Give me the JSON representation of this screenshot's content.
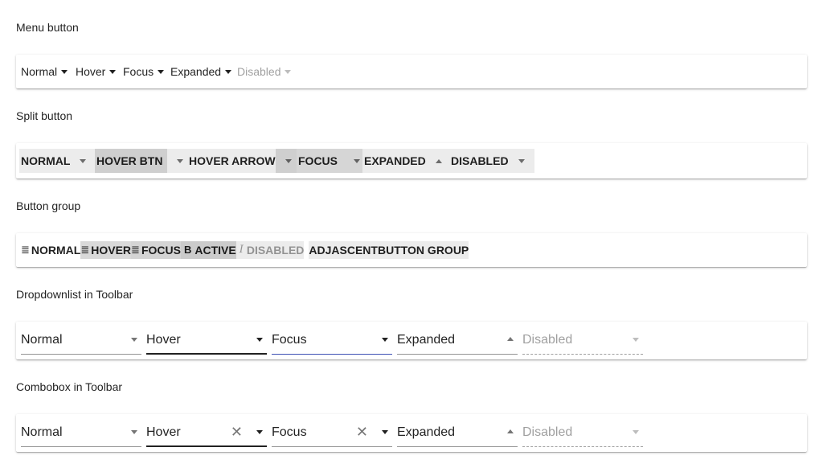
{
  "sections": {
    "menu_button": {
      "label": "Menu button",
      "items": [
        "Normal",
        "Hover",
        "Focus",
        "Expanded",
        "Disabled"
      ]
    },
    "split_button": {
      "label": "Split button",
      "items": [
        "NORMAL",
        "HOVER BTN",
        "HOVER ARROW",
        "FOCUS",
        "EXPANDED",
        "DISABLED"
      ]
    },
    "button_group": {
      "label": "Button group",
      "items": [
        {
          "icon": "align-justify-icon",
          "glyph": "≣",
          "label": "NORMAL"
        },
        {
          "icon": "align-justify-icon",
          "glyph": "≣",
          "label": "HOVER"
        },
        {
          "icon": "align-justify-icon",
          "glyph": "≣",
          "label": "FOCUS"
        },
        {
          "icon": "bold-icon",
          "glyph": "B",
          "label": "ACTIVE"
        },
        {
          "icon": "italic-icon",
          "glyph": "I",
          "label": "DISABLED"
        }
      ],
      "adjacent_a": "ADJASCENT",
      "adjacent_b": "BUTTON GROUP"
    },
    "dropdownlist": {
      "label": "Dropdownlist in Toolbar",
      "items": [
        "Normal",
        "Hover",
        "Focus",
        "Expanded",
        "Disabled"
      ]
    },
    "combobox": {
      "label": "Combobox in Toolbar",
      "items": [
        "Normal",
        "Hover",
        "Focus",
        "Expanded",
        "Disabled"
      ],
      "clear_glyph": "✕"
    }
  },
  "colors": {
    "focus_underline": "#3f51b5",
    "hover_bg": "#cfcfcf",
    "button_bg": "#ececec"
  }
}
